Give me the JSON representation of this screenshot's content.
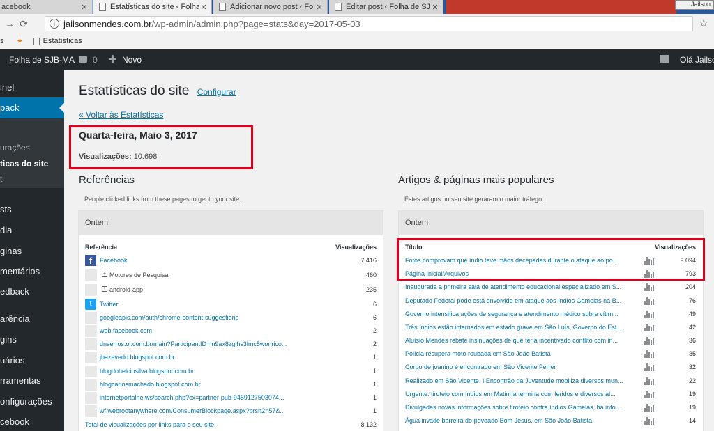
{
  "browser": {
    "tabs": [
      {
        "title": "acebook"
      },
      {
        "title": "Estatísticas do site ‹ Folha"
      },
      {
        "title": "Adicionar novo post ‹ Fo"
      },
      {
        "title": "Editar post ‹ Folha de SJB"
      }
    ],
    "window_label": "Jailson",
    "url_host": "jailsonmendes.com.br",
    "url_path": "/wp-admin/admin.php?page=stats&day=2017-05-03",
    "bookmark_apps": "s",
    "bookmark": "Estatísticas"
  },
  "adminbar": {
    "site": "Folha de SJB-MA",
    "comments": "0",
    "new": "Novo",
    "greeting": "Olá Jailson"
  },
  "sidebar": {
    "items": [
      "inel",
      "pack"
    ],
    "sub": [
      "urações",
      "ticas do site",
      "t"
    ],
    "rest": [
      "sts",
      "dia",
      "ginas",
      "mentários",
      "edback",
      "arência",
      "gins",
      "uários",
      "rramentas",
      "onfigurações",
      "cebook"
    ]
  },
  "main": {
    "title": "Estatísticas do site",
    "configure": "Configurar",
    "back": "« Voltar às Estatísticas",
    "date": "Quarta-feira, Maio 3, 2017",
    "views_label": "Visualizações:",
    "views_value": "10.698"
  },
  "referrers": {
    "title": "Referências",
    "desc": "People clicked links from these pages to get to your site.",
    "period": "Ontem",
    "col1": "Referência",
    "col2": "Visualizações",
    "rows": [
      {
        "label": "Facebook",
        "value": "7.416"
      },
      {
        "label": "Motores de Pesquisa",
        "value": "460"
      },
      {
        "label": "android-app",
        "value": "235"
      },
      {
        "label": "Twitter",
        "value": "6"
      },
      {
        "label": "googleapis.com/auth/chrome-content-suggestions",
        "value": "6"
      },
      {
        "label": "web.facebook.com",
        "value": "2"
      },
      {
        "label": "dnserros.oi.com.br/main?ParticipantID=in9ax8zglhs3lmc5wonrico...",
        "value": "2"
      },
      {
        "label": "jbazevedo.blogspot.com.br",
        "value": "1"
      },
      {
        "label": "blogdohelciosilva.blogspot.com.br",
        "value": "1"
      },
      {
        "label": "blogcarlosmachado.blogspot.com.br",
        "value": "1"
      },
      {
        "label": "internetportalne.ws/search.php?cx=partner-pub-9459127503074...",
        "value": "1"
      },
      {
        "label": "wf.webrootanywhere.com/ConsumerBlockpage.aspx?brsn2=57&...",
        "value": "1"
      }
    ],
    "total_label": "Total de visualizações por links para o seu site",
    "total_value": "8.132"
  },
  "posts": {
    "title": "Artigos & páginas mais populares",
    "desc": "Estes artigos no seu site geraram o maior tráfego.",
    "period": "Ontem",
    "col1": "Título",
    "col2": "Visualizações",
    "rows": [
      {
        "label": "Fotos comprovam que índio teve mãos decepadas durante o ataque ao po...",
        "value": "9.094"
      },
      {
        "label": "Página Inicial/Arquivos",
        "value": "793"
      },
      {
        "label": "Inaugurada a primeira sala de atendimento educacional especializado em S...",
        "value": "204"
      },
      {
        "label": "Deputado Federal pode está envolvido em ataque aos índios Gamelas na B...",
        "value": "76"
      },
      {
        "label": "Governo intensifica ações de segurança e atendimento médico sobre vítim...",
        "value": "49"
      },
      {
        "label": "Três índios estão internados em estado grave em São Luís, Governo do Est...",
        "value": "42"
      },
      {
        "label": "Aluísio Mendes rebate insinuações de que teria incentivado conflito com in...",
        "value": "36"
      },
      {
        "label": "Polícia recupera moto roubada em São João Batista",
        "value": "35"
      },
      {
        "label": "Corpo de joanino é encontrado em São Vicente Ferrer",
        "value": "32"
      },
      {
        "label": "Realizado em São Vicente, I Encontrão da Juventude mobiliza diversos mun...",
        "value": "22"
      },
      {
        "label": "Urgente: tiroteio com índios em Matinha termina com feridos e diversos al...",
        "value": "19"
      },
      {
        "label": "Divulgadas novas informações sobre tiroteio contra índios Gamelas, há info...",
        "value": "19"
      },
      {
        "label": "Água invade barreira do povoado Bom Jesus, em São João Batista",
        "value": "14"
      }
    ]
  }
}
